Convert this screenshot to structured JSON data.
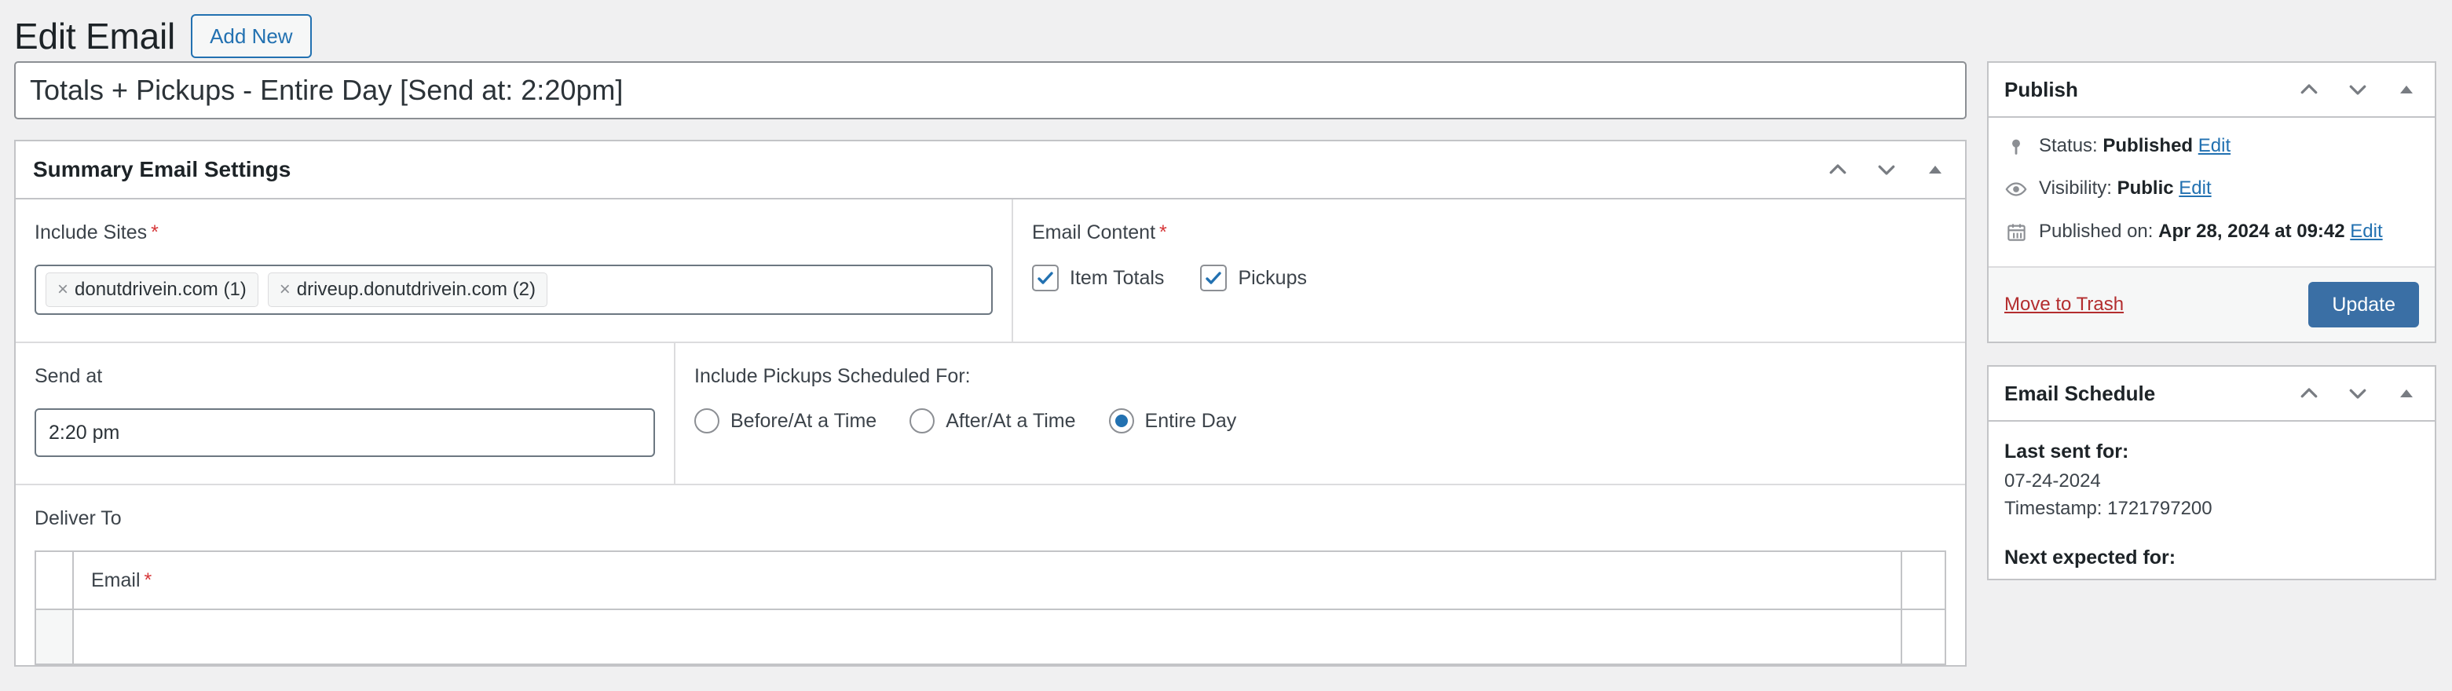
{
  "header": {
    "page_title": "Edit Email",
    "add_new_label": "Add New"
  },
  "post": {
    "title_value": "Totals + Pickups - Entire Day [Send at: 2:20pm]"
  },
  "settings_panel": {
    "title": "Summary Email Settings",
    "controls": {
      "move_up": "chevron-up-icon",
      "move_down": "chevron-down-icon",
      "toggle": "triangle-up-icon"
    },
    "include_sites": {
      "label": "Include Sites",
      "required_marker": "*",
      "tags": [
        {
          "remove": "×",
          "label": "donutdrivein.com (1)"
        },
        {
          "remove": "×",
          "label": "driveup.donutdrivein.com (2)"
        }
      ]
    },
    "email_content": {
      "label": "Email Content",
      "required_marker": "*",
      "options": [
        {
          "label": "Item Totals",
          "checked": true
        },
        {
          "label": "Pickups",
          "checked": true
        }
      ]
    },
    "send_at": {
      "label": "Send at",
      "value": "2:20 pm"
    },
    "pickups_scheduled": {
      "label": "Include Pickups Scheduled For:",
      "options": [
        {
          "label": "Before/At a Time",
          "selected": false
        },
        {
          "label": "After/At a Time",
          "selected": false
        },
        {
          "label": "Entire Day",
          "selected": true
        }
      ]
    },
    "deliver_to": {
      "label": "Deliver To",
      "columns": [
        "",
        "Email",
        ""
      ],
      "email_required_marker": "*"
    }
  },
  "publish_box": {
    "title": "Publish",
    "status": {
      "prefix": "Status:",
      "value": "Published",
      "edit": "Edit"
    },
    "visibility": {
      "prefix": "Visibility:",
      "value": "Public",
      "edit": "Edit"
    },
    "published_on": {
      "prefix": "Published on:",
      "value": "Apr 28, 2024 at 09:42",
      "edit": "Edit"
    },
    "trash_label": "Move to Trash",
    "update_label": "Update"
  },
  "schedule_box": {
    "title": "Email Schedule",
    "last_sent_label": "Last sent for:",
    "last_sent_date": "07-24-2024",
    "last_sent_timestamp": "Timestamp: 1721797200",
    "next_expected_label": "Next expected for:"
  },
  "colors": {
    "accent": "#2271b1",
    "update_button": "#3a6fa5",
    "required": "#d63638",
    "trash": "#b32d2e",
    "background": "#f0f0f1"
  }
}
